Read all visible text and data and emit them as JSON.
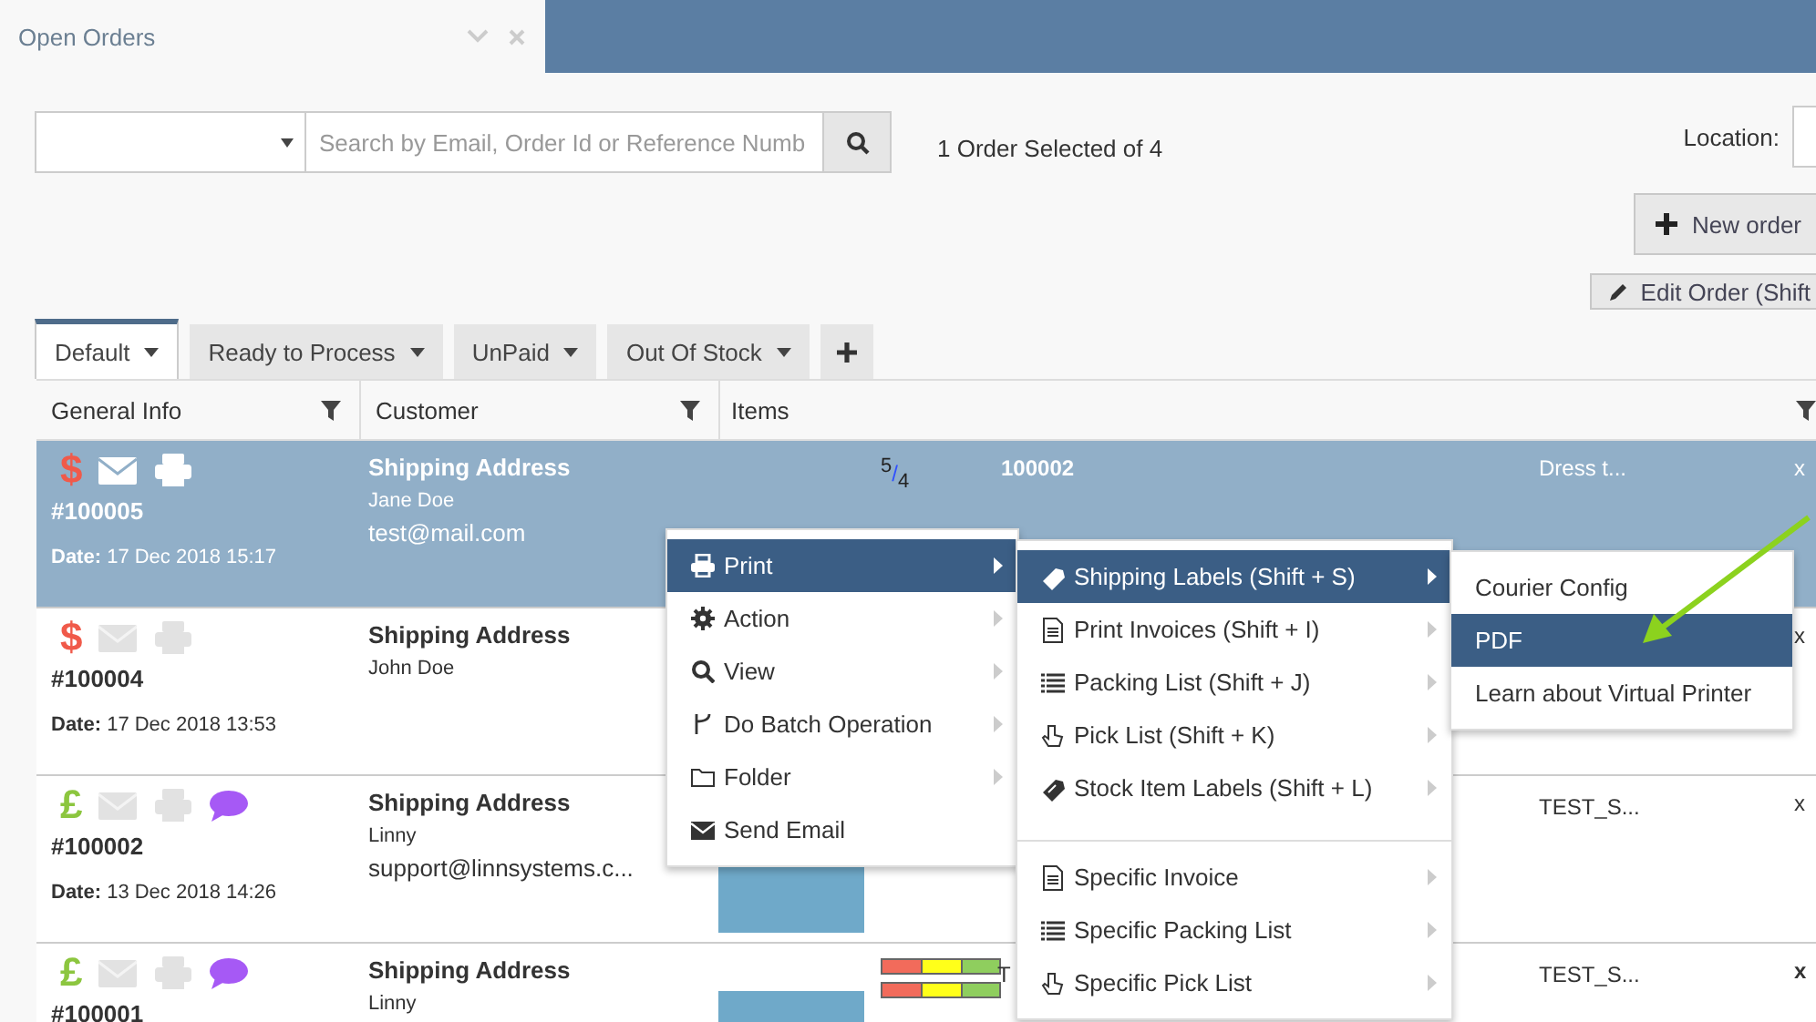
{
  "header": {
    "title": "Open Orders"
  },
  "toolbar": {
    "search_placeholder": "Search by Email, Order Id or Reference Numb",
    "selection_status": "1 Order Selected of 4",
    "location_label": "Location:"
  },
  "actions": [
    {
      "label": "New order",
      "kind": "add"
    },
    {
      "label": "Edit Order (Shift",
      "kind": "edit"
    }
  ],
  "view_tabs": [
    {
      "label": "Default",
      "selected": true
    },
    {
      "label": "Ready to Process",
      "selected": false
    },
    {
      "label": "UnPaid",
      "selected": false
    },
    {
      "label": "Out Of Stock",
      "selected": false
    }
  ],
  "table": {
    "columns": [
      {
        "label": "General Info",
        "filter": true
      },
      {
        "label": "Customer",
        "filter": true
      },
      {
        "label": "Items",
        "filter": true
      }
    ],
    "rows": [
      {
        "selected": true,
        "currency": "$",
        "paid": false,
        "has_notes": false,
        "order_id": "#100005",
        "date_label": "Date:",
        "date": "17 Dec 2018 15:17",
        "address_heading": "Shipping Address",
        "name": "Jane Doe",
        "email": "test@mail.com",
        "item": {
          "photo": false,
          "stock_bars": false,
          "availability": "$^{5}$/$_{4}$",
          "sku": "100002",
          "title": "Dress t...",
          "qty": "x"
        }
      },
      {
        "selected": false,
        "currency": "$",
        "paid": false,
        "has_notes": false,
        "order_id": "#100004",
        "date_label": "Date:",
        "date": "17 Dec 2018 13:53",
        "address_heading": "Shipping Address",
        "name": "John Doe",
        "item": {
          "photo": false,
          "stock_bars": false,
          "qty": "x"
        }
      },
      {
        "selected": false,
        "currency": "£",
        "paid": true,
        "has_notes": true,
        "order_id": "#100002",
        "date_label": "Date:",
        "date": "13 Dec 2018 14:26",
        "address_heading": "Shipping Address",
        "name": "Linny",
        "email": "support@linnsystems.c...",
        "item": {
          "photo": true,
          "stock_bars": false,
          "title": "TEST_S...",
          "qty": "x"
        }
      },
      {
        "selected": false,
        "currency": "£",
        "paid": true,
        "has_notes": true,
        "order_id": "#100001",
        "address_heading": "Shipping Address",
        "name": "Linny",
        "item": {
          "photo": true,
          "stock_bars": true,
          "sku": "T",
          "title": "TEST_S...",
          "qty": "x"
        }
      }
    ]
  },
  "context_menu": {
    "items": [
      {
        "label": "Print",
        "kind": "print",
        "selected": true,
        "has_submenu": true
      },
      {
        "label": "Action",
        "kind": "gear",
        "selected": false,
        "has_submenu": true
      },
      {
        "label": "View",
        "kind": "search",
        "selected": false,
        "has_submenu": true
      },
      {
        "label": "Do Batch Operation",
        "kind": "branch",
        "selected": false,
        "has_submenu": true
      },
      {
        "label": "Folder",
        "kind": "folder",
        "selected": false,
        "has_submenu": true
      },
      {
        "label": "Send Email",
        "kind": "envelope",
        "selected": false,
        "has_submenu": false
      }
    ]
  },
  "print_submenu": {
    "groups": [
      [
        {
          "label": "Shipping Labels (Shift + S)",
          "kind": "tag",
          "selected": true,
          "has_submenu": true
        },
        {
          "label": "Print Invoices (Shift + I)",
          "kind": "document",
          "selected": false,
          "has_submenu": true
        },
        {
          "label": "Packing List (Shift + J)",
          "kind": "list",
          "selected": false,
          "has_submenu": true
        },
        {
          "label": "Pick List (Shift + K)",
          "kind": "hand",
          "selected": false,
          "has_submenu": true
        },
        {
          "label": "Stock Item Labels (Shift + L)",
          "kind": "tag",
          "selected": false,
          "has_submenu": true
        }
      ],
      [
        {
          "label": "Specific Invoice",
          "kind": "document",
          "selected": false,
          "has_submenu": true
        },
        {
          "label": "Specific Packing List",
          "kind": "list",
          "selected": false,
          "has_submenu": true
        },
        {
          "label": "Specific Pick List",
          "kind": "hand",
          "selected": false,
          "has_submenu": true
        }
      ]
    ]
  },
  "label_submenu": {
    "items": [
      {
        "label": "Courier Config",
        "selected": false
      },
      {
        "label": "PDF",
        "selected": true
      },
      {
        "label": "Learn about Virtual Printer",
        "selected": false
      }
    ]
  },
  "annotation": {
    "arrow": true
  }
}
